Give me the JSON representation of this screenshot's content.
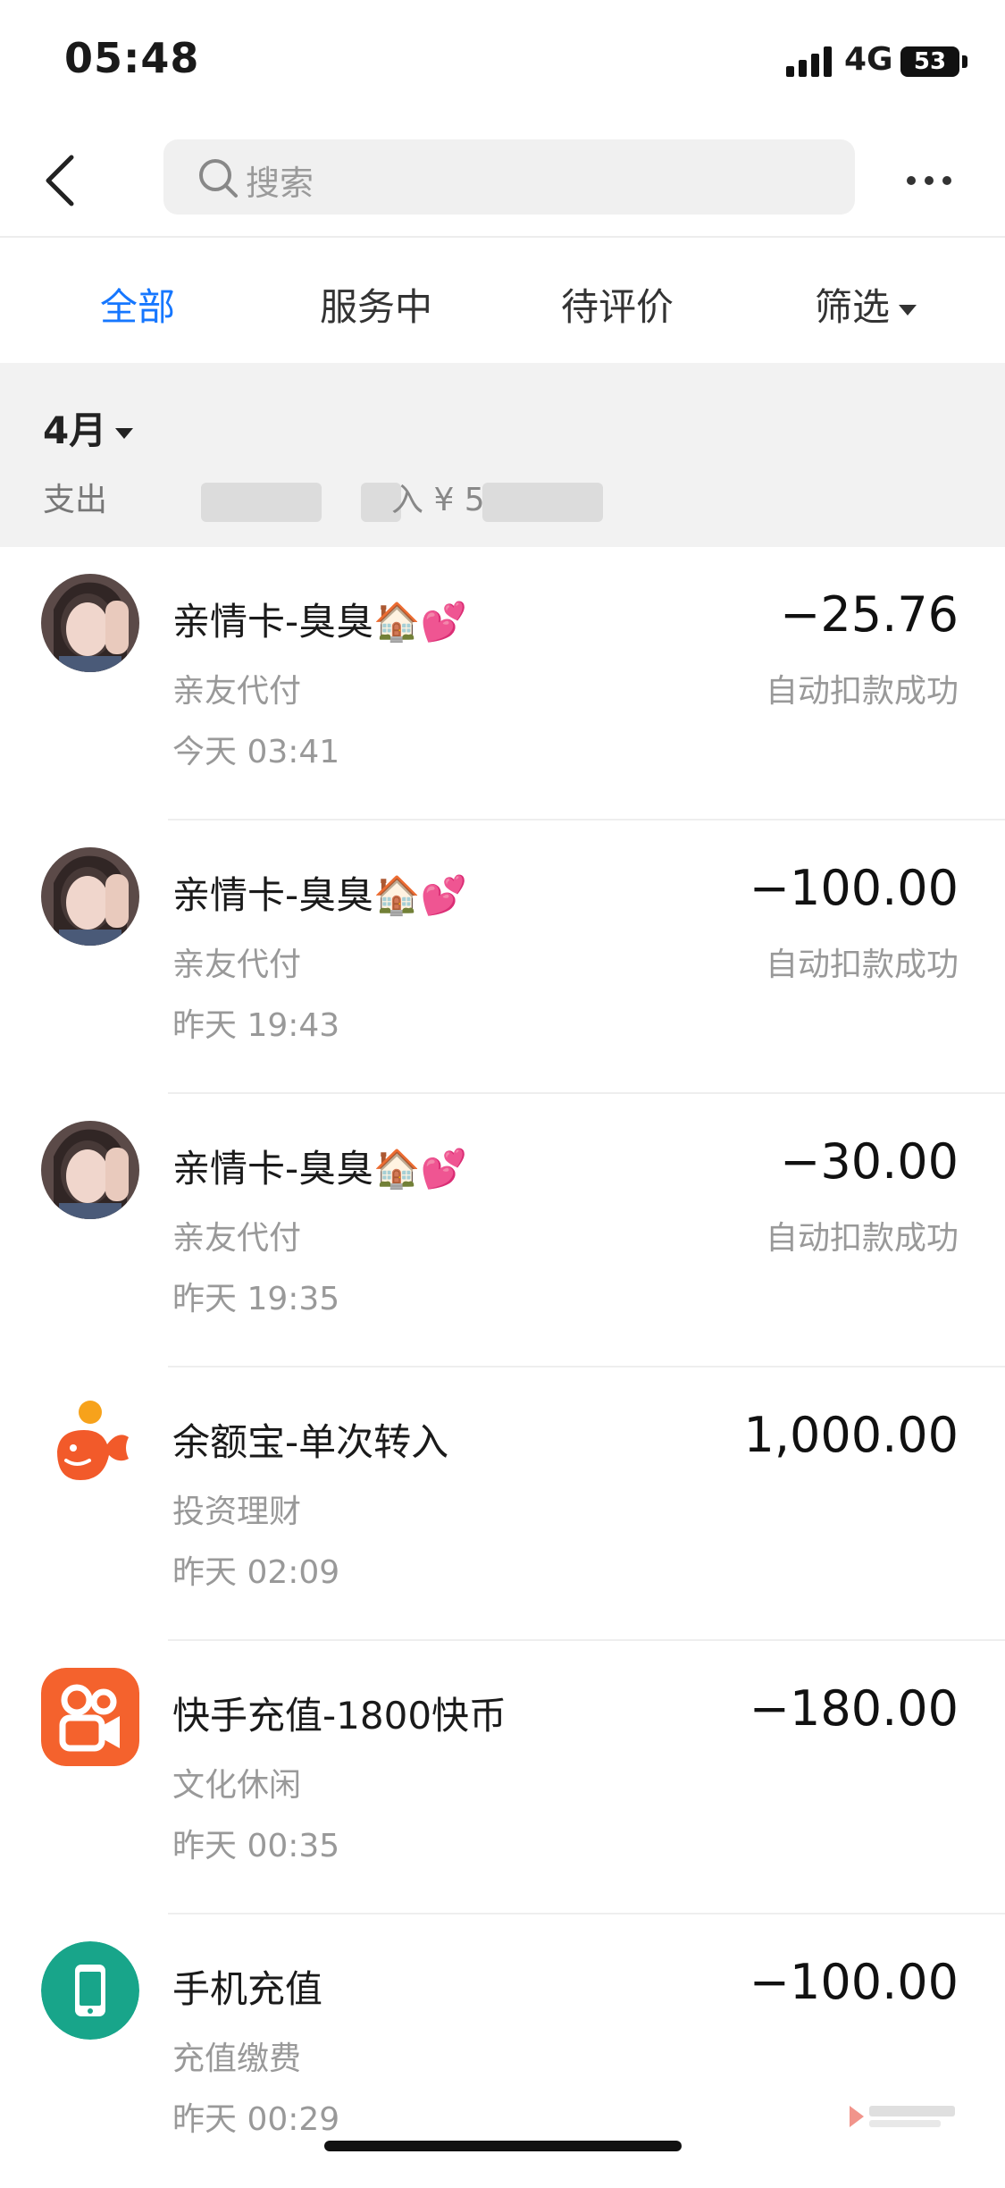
{
  "status_bar": {
    "time": "05:48",
    "network": "4G",
    "battery": "53"
  },
  "nav": {
    "search_placeholder": "搜索"
  },
  "tabs": [
    {
      "label": "全部",
      "active": true
    },
    {
      "label": "服务中",
      "active": false
    },
    {
      "label": "待评价",
      "active": false
    },
    {
      "label": "筛选",
      "active": false
    }
  ],
  "month": {
    "label": "4月",
    "summary_prefix": "支出",
    "summary_partial": "入 ¥ 5"
  },
  "transactions": [
    {
      "title": "亲情卡-臭臭🏠💕",
      "category": "亲友代付",
      "time": "今天  03:41",
      "amount": "−25.76",
      "status": "自动扣款成功",
      "icon": "user-avatar-photo"
    },
    {
      "title": "亲情卡-臭臭🏠💕",
      "category": "亲友代付",
      "time": "昨天  19:43",
      "amount": "−100.00",
      "status": "自动扣款成功",
      "icon": "user-avatar-photo"
    },
    {
      "title": "亲情卡-臭臭🏠💕",
      "category": "亲友代付",
      "time": "昨天  19:35",
      "amount": "−30.00",
      "status": "自动扣款成功",
      "icon": "user-avatar-photo"
    },
    {
      "title": "余额宝-单次转入",
      "category": "投资理财",
      "time": "昨天  02:09",
      "amount": "1,000.00",
      "status": "",
      "icon": "yuebao-icon"
    },
    {
      "title": "快手充值-1800快币",
      "category": "文化休闲",
      "time": "昨天  00:35",
      "amount": "−180.00",
      "status": "",
      "icon": "kuaishou-icon"
    },
    {
      "title": "手机充值",
      "category": "充值缴费",
      "time": "昨天  00:29",
      "amount": "−100.00",
      "status": "",
      "icon": "phone-recharge-icon"
    }
  ],
  "colors": {
    "accent": "#1677ff",
    "yuebao": "#f25a2a",
    "kuaishou": "#f4622d",
    "phone": "#18a58a"
  }
}
